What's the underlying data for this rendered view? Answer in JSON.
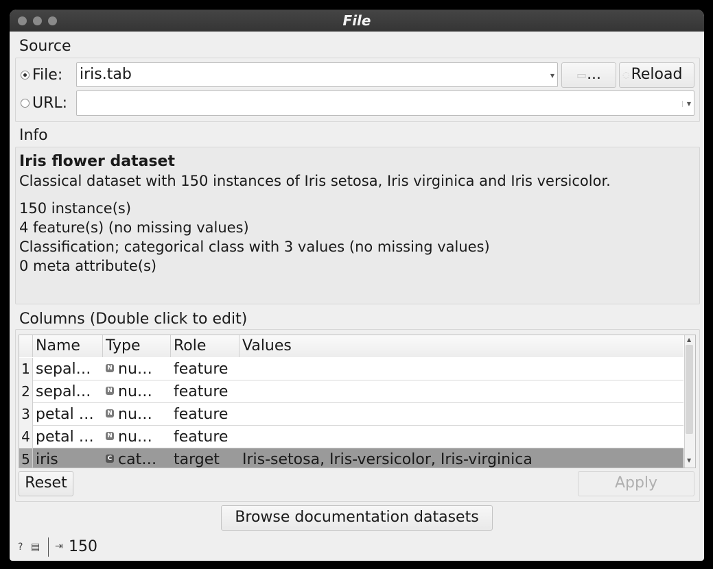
{
  "window": {
    "title": "File"
  },
  "source": {
    "heading": "Source",
    "file_label": "File:",
    "file_value": "iris.tab",
    "browse_label": "...",
    "reload_label": "Reload",
    "url_label": "URL:",
    "url_value": "",
    "selected": "file"
  },
  "info": {
    "heading": "Info",
    "title": "Iris flower dataset",
    "description": "Classical dataset with 150 instances of Iris setosa, Iris virginica and Iris versicolor.",
    "lines": [
      "150 instance(s)",
      "4 feature(s) (no missing values)",
      "Classification; categorical class with 3 values (no missing values)",
      "0 meta attribute(s)"
    ]
  },
  "columns": {
    "heading": "Columns (Double click to edit)",
    "headers": [
      "Name",
      "Type",
      "Role",
      "Values"
    ],
    "rows": [
      {
        "index": "1",
        "name": "sepal…",
        "type_badge": "N",
        "type": "nu…",
        "role": "feature",
        "values": ""
      },
      {
        "index": "2",
        "name": "sepal…",
        "type_badge": "N",
        "type": "nu…",
        "role": "feature",
        "values": ""
      },
      {
        "index": "3",
        "name": "petal …",
        "type_badge": "N",
        "type": "nu…",
        "role": "feature",
        "values": ""
      },
      {
        "index": "4",
        "name": "petal …",
        "type_badge": "N",
        "type": "nu…",
        "role": "feature",
        "values": ""
      },
      {
        "index": "5",
        "name": "iris",
        "type_badge": "C",
        "type": "cat…",
        "role": "target",
        "values": "Iris-setosa, Iris-versicolor, Iris-virginica"
      }
    ],
    "selected_row": 4
  },
  "buttons": {
    "reset": "Reset",
    "apply": "Apply",
    "browse_docs": "Browse documentation datasets"
  },
  "status": {
    "output_count": "150"
  },
  "icons": {
    "help": "question-icon",
    "report": "document-icon",
    "output": "output-icon",
    "folder": "folder-icon"
  }
}
